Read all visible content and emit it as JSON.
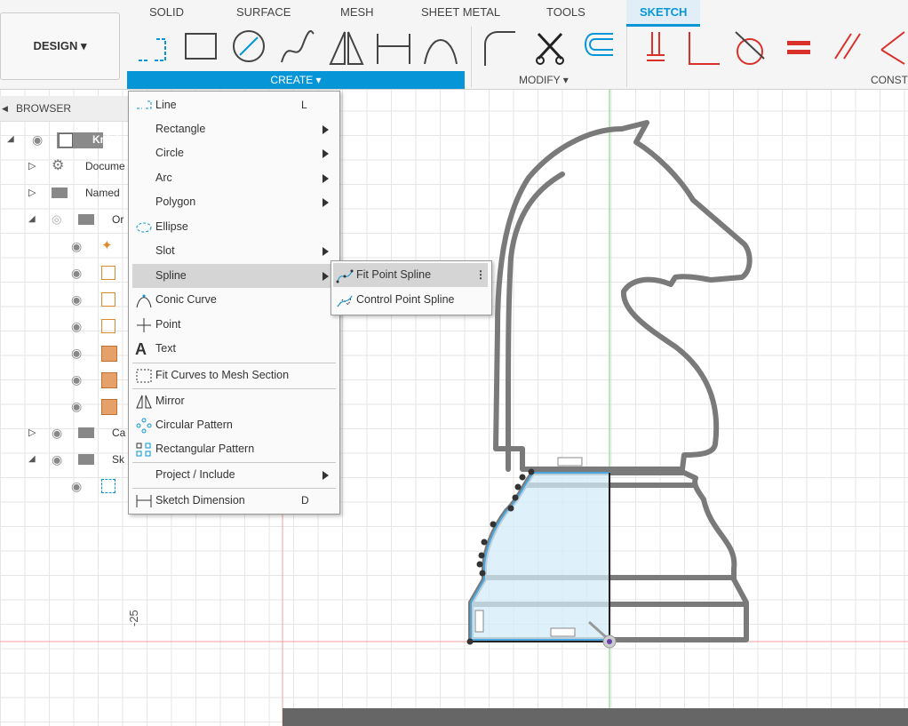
{
  "toolbar": {
    "design_label": "DESIGN ▾",
    "tabs": [
      {
        "label": "SOLID"
      },
      {
        "label": "SURFACE"
      },
      {
        "label": "MESH"
      },
      {
        "label": "SHEET METAL"
      },
      {
        "label": "TOOLS"
      },
      {
        "label": "SKETCH"
      }
    ],
    "create_label": "CREATE ▾",
    "modify_label": "MODIFY ▾",
    "constrain_label": "CONST",
    "accent_color": "#0696d7"
  },
  "browser": {
    "title": "BROWSER",
    "rows": [
      {
        "label": "Knigh"
      },
      {
        "label": "Docume"
      },
      {
        "label": "Named"
      },
      {
        "label": "Or"
      },
      {
        "label": "Ca"
      },
      {
        "label": "Sk"
      }
    ]
  },
  "create_menu": {
    "items": [
      {
        "label": "Line",
        "shortcut": "L"
      },
      {
        "label": "Rectangle"
      },
      {
        "label": "Circle"
      },
      {
        "label": "Arc"
      },
      {
        "label": "Polygon"
      },
      {
        "label": "Ellipse"
      },
      {
        "label": "Slot"
      },
      {
        "label": "Spline"
      },
      {
        "label": "Conic Curve"
      },
      {
        "label": "Point"
      },
      {
        "label": "Text"
      },
      {
        "label": "Fit Curves to Mesh Section"
      },
      {
        "label": "Mirror"
      },
      {
        "label": "Circular Pattern"
      },
      {
        "label": "Rectangular Pattern"
      },
      {
        "label": "Project / Include"
      },
      {
        "label": "Sketch Dimension",
        "shortcut": "D"
      }
    ]
  },
  "spline_submenu": {
    "items": [
      {
        "label": "Fit Point Spline"
      },
      {
        "label": "Control Point Spline"
      }
    ]
  },
  "canvas": {
    "axis_label": "-25"
  }
}
